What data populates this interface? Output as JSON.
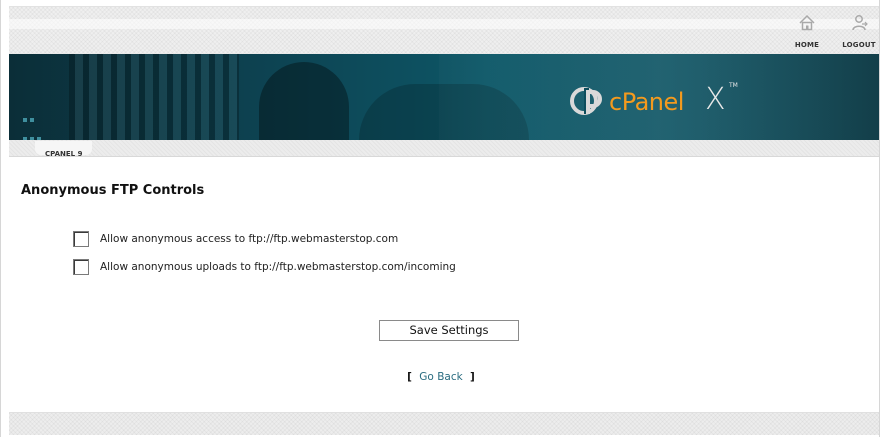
{
  "topnav": {
    "home_label": "HOME",
    "logout_label": "LOGOUT"
  },
  "banner": {
    "brand": "cPanel",
    "version_mark": "X",
    "trademark": "TM",
    "brand_color": "#f39a1e"
  },
  "breadcrumb": {
    "label": "CPANEL 9"
  },
  "main": {
    "title": "Anonymous FTP Controls",
    "options": [
      {
        "label": "Allow anonymous access to ftp://ftp.webmasterstop.com",
        "checked": false
      },
      {
        "label": "Allow anonymous uploads to ftp://ftp.webmasterstop.com/incoming",
        "checked": false
      }
    ],
    "save_label": "Save Settings",
    "goback": {
      "open_bracket": "[",
      "label": "Go Back",
      "close_bracket": "]"
    }
  },
  "colors": {
    "link": "#2a6c80",
    "banner_dark": "#0b2e38",
    "banner_mid": "#0d5666"
  },
  "icons": {
    "home": "home-icon",
    "logout": "logout-icon",
    "logo": "cpanel-logo-icon"
  }
}
